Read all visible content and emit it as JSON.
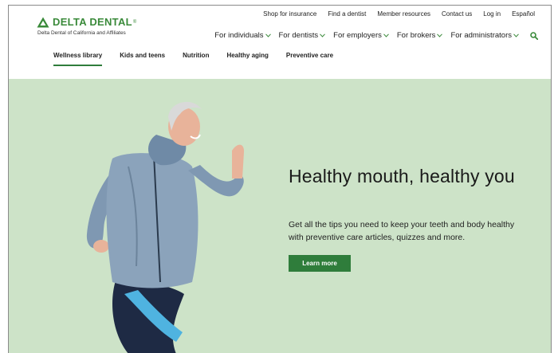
{
  "brand": {
    "name": "DELTA DENTAL",
    "tm": "®",
    "subtitle": "Delta Dental of California and Affiliates",
    "color": "#3a8a3a"
  },
  "utility_nav": [
    "Shop for insurance",
    "Find a dentist",
    "Member resources",
    "Contact us",
    "Log in",
    "Español"
  ],
  "main_nav": [
    "For individuals",
    "For dentists",
    "For employers",
    "For brokers",
    "For administrators"
  ],
  "sub_nav": {
    "items": [
      "Wellness library",
      "Kids and teens",
      "Nutrition",
      "Healthy aging",
      "Preventive care"
    ],
    "active": "Wellness library"
  },
  "hero": {
    "title": "Healthy mouth, healthy you",
    "text": "Get all the tips you need to keep your teeth and body healthy with preventive care articles, quizzes and more.",
    "button_label": "Learn more",
    "background": "#cde3c8",
    "button_color": "#2f7d3b"
  }
}
